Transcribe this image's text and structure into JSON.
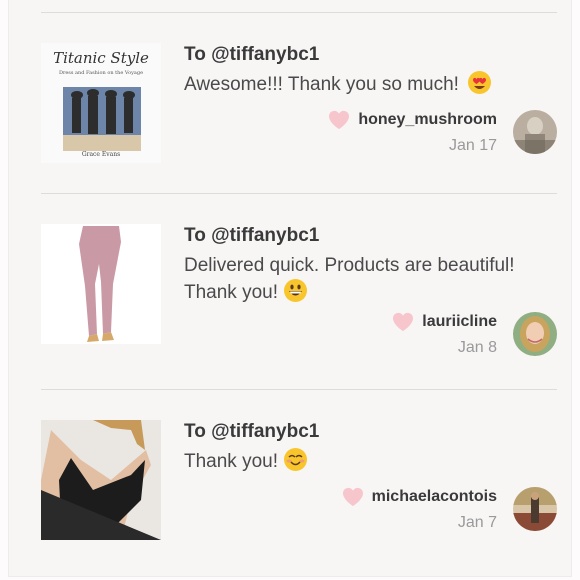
{
  "reviews": [
    {
      "to": "To @tiffanybc1",
      "message": "Awesome!!! Thank you so much!",
      "emoji": "heart-eyes-emoji",
      "username": "honey_mushroom",
      "date": "Jan 17",
      "book": {
        "title": "Titanic Style",
        "subtitle": "Dress and Fashion on the Voyage",
        "author": "Grace Evans"
      }
    },
    {
      "to": "To @tiffanybc1",
      "message": "Delivered quick. Products are beautiful! Thank you!",
      "emoji": "grinning-emoji",
      "username": "lauriicline",
      "date": "Jan 8"
    },
    {
      "to": "To @tiffanybc1",
      "message": "Thank you!",
      "emoji": "smiling-blush-emoji",
      "username": "michaelacontois",
      "date": "Jan 7"
    }
  ],
  "colors": {
    "heart": "#f7c6cc",
    "divider": "#dcdcdc",
    "card_background": "#f8f5f5",
    "emoji_yellow": "#f8c62c"
  }
}
